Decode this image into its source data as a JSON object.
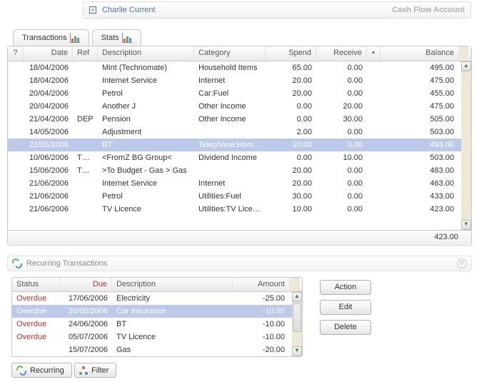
{
  "account": {
    "name": "Charlie Current",
    "subtitle": "Cash Flow Account"
  },
  "tabs": [
    {
      "label": "Transactions",
      "icon": "chart-icon"
    },
    {
      "label": "Stats",
      "icon": "chart-icon"
    }
  ],
  "columns": {
    "help": "?",
    "date": "Date",
    "ref": "Ref",
    "desc": "Description",
    "cat": "Category",
    "spend": "Spend",
    "recv": "Receive",
    "dot": "•",
    "bal": "Balance"
  },
  "transactions": [
    {
      "date": "18/04/2006",
      "ref": "",
      "desc": "Mint (Technomate)",
      "cat": "Household Items",
      "spend": "65.00",
      "recv": "0.00",
      "bal": "495.00",
      "sel": false
    },
    {
      "date": "18/04/2006",
      "ref": "",
      "desc": "Internet Service",
      "cat": "Internet",
      "spend": "20.00",
      "recv": "0.00",
      "bal": "475.00",
      "sel": false
    },
    {
      "date": "20/04/2006",
      "ref": "",
      "desc": "Petrol",
      "cat": "Car:Fuel",
      "spend": "20.00",
      "recv": "0.00",
      "bal": "455.00",
      "sel": false
    },
    {
      "date": "20/04/2006",
      "ref": "",
      "desc": "Another J",
      "cat": "Other Income",
      "spend": "0.00",
      "recv": "20.00",
      "bal": "475.00",
      "sel": false
    },
    {
      "date": "21/04/2006",
      "ref": "DEP",
      "desc": "Pension",
      "cat": "Other Income",
      "spend": "0.00",
      "recv": "30.00",
      "bal": "505.00",
      "sel": false
    },
    {
      "date": "14/05/2006",
      "ref": "",
      "desc": "Adjustment",
      "cat": "",
      "spend": "2.00",
      "recv": "0.00",
      "bal": "503.00",
      "sel": false
    },
    {
      "date": "22/05/2006",
      "ref": "",
      "desc": "BT",
      "cat": "Telephone:Hom..",
      "spend": "10.00",
      "recv": "0.00",
      "bal": "493.00",
      "sel": true
    },
    {
      "date": "10/06/2006",
      "ref": "TXFR",
      "desc": "<FromZ BG Group<",
      "cat": "Dividend Income",
      "spend": "0.00",
      "recv": "10.00",
      "bal": "503.00",
      "sel": false
    },
    {
      "date": "15/06/2006",
      "ref": "TXFR",
      "desc": ">To Budget - Gas > Gas",
      "cat": "",
      "spend": "20.00",
      "recv": "0.00",
      "bal": "483.00",
      "sel": false
    },
    {
      "date": "21/06/2006",
      "ref": "",
      "desc": "Internet Service",
      "cat": "Internet",
      "spend": "20.00",
      "recv": "0.00",
      "bal": "463.00",
      "sel": false
    },
    {
      "date": "21/06/2006",
      "ref": "",
      "desc": "Petrol",
      "cat": "Utilities:Fuel",
      "spend": "30.00",
      "recv": "0.00",
      "bal": "433.00",
      "sel": false
    },
    {
      "date": "21/06/2006",
      "ref": "",
      "desc": "TV Licence",
      "cat": "Utilities:TV Licence",
      "spend": "10.00",
      "recv": "0.00",
      "bal": "423.00",
      "sel": false
    }
  ],
  "footer_balance": "423.00",
  "recurring_title": "Recurring Transactions",
  "rcolumns": {
    "status": "Status",
    "due": "Due",
    "desc": "Description",
    "amt": "Amount"
  },
  "recurring": [
    {
      "status": "Overdue",
      "due": "17/06/2006",
      "desc": "Electricity",
      "amt": "-25.00",
      "sel": false
    },
    {
      "status": "Overdue",
      "due": "20/06/2006",
      "desc": "Car Insurance",
      "amt": "-10.00",
      "sel": true
    },
    {
      "status": "Overdue",
      "due": "24/06/2006",
      "desc": "BT",
      "amt": "-10.00",
      "sel": false
    },
    {
      "status": "Overdue",
      "due": "05/07/2006",
      "desc": "TV Licence",
      "amt": "-10.00",
      "sel": false
    },
    {
      "status": "",
      "due": "15/07/2006",
      "desc": "Gas",
      "amt": "-20.00",
      "sel": false
    }
  ],
  "buttons": {
    "action": "Action",
    "edit": "Edit",
    "delete": "Delete",
    "recurring": "Recurring",
    "filter": "Filter"
  }
}
